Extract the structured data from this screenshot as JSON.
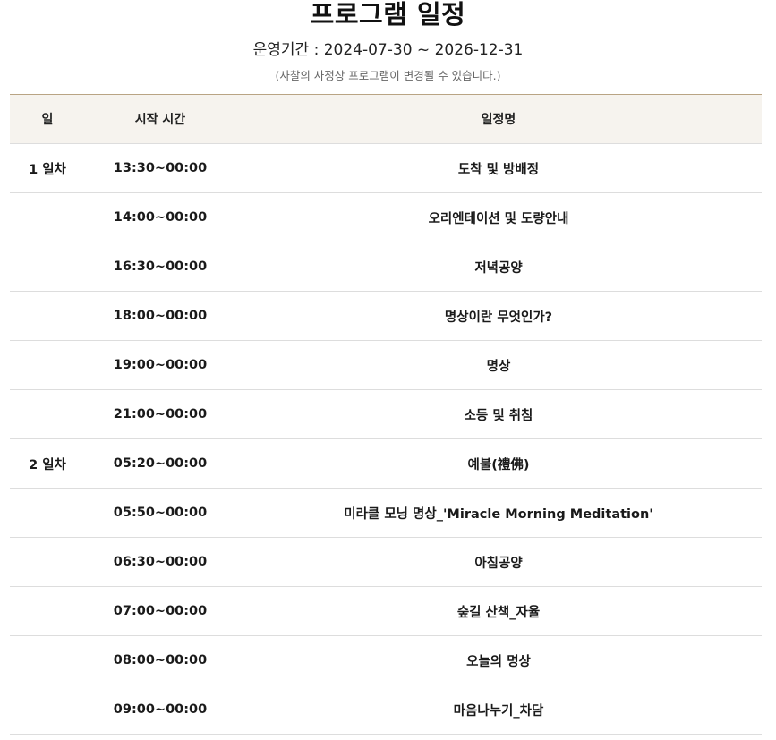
{
  "page": {
    "title": "프로그램 일정",
    "period": "운영기간 : 2024-07-30 ~ 2026-12-31",
    "notice": "(사찰의 사정상 프로그램이 변경될 수 있습니다.)"
  },
  "table": {
    "headers": {
      "day": "일",
      "time": "시작 시간",
      "name": "일정명"
    },
    "rows": [
      {
        "day": "1 일차",
        "time": "13:30~00:00",
        "name": "도착 및 방배정"
      },
      {
        "day": "",
        "time": "14:00~00:00",
        "name": "오리엔테이션 및 도량안내"
      },
      {
        "day": "",
        "time": "16:30~00:00",
        "name": "저녁공양"
      },
      {
        "day": "",
        "time": "18:00~00:00",
        "name": "명상이란 무엇인가?"
      },
      {
        "day": "",
        "time": "19:00~00:00",
        "name": "명상"
      },
      {
        "day": "",
        "time": "21:00~00:00",
        "name": "소등 및 취침"
      },
      {
        "day": "2 일차",
        "time": "05:20~00:00",
        "name": "예불(禮佛)"
      },
      {
        "day": "",
        "time": "05:50~00:00",
        "name": "미라클 모닝 명상_'Miracle Morning Meditation'"
      },
      {
        "day": "",
        "time": "06:30~00:00",
        "name": "아침공양"
      },
      {
        "day": "",
        "time": "07:00~00:00",
        "name": "숲길 산책_자율"
      },
      {
        "day": "",
        "time": "08:00~00:00",
        "name": "오늘의 명상"
      },
      {
        "day": "",
        "time": "09:00~00:00",
        "name": "마음나누기_차담"
      }
    ]
  }
}
